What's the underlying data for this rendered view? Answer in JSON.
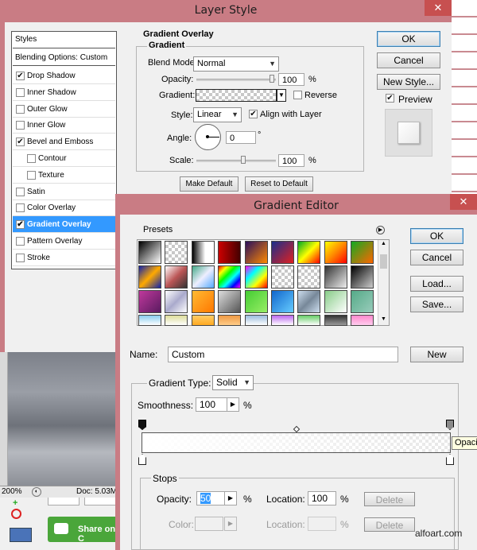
{
  "layer_style": {
    "title": "Layer Style",
    "close": "✕",
    "styles_header": "Styles",
    "blending_options": "Blending Options: Custom",
    "styles": [
      {
        "label": "Drop Shadow",
        "checked": true,
        "indent": false,
        "selected": false
      },
      {
        "label": "Inner Shadow",
        "checked": false,
        "indent": false,
        "selected": false
      },
      {
        "label": "Outer Glow",
        "checked": false,
        "indent": false,
        "selected": false
      },
      {
        "label": "Inner Glow",
        "checked": false,
        "indent": false,
        "selected": false
      },
      {
        "label": "Bevel and Emboss",
        "checked": true,
        "indent": false,
        "selected": false
      },
      {
        "label": "Contour",
        "checked": false,
        "indent": true,
        "selected": false
      },
      {
        "label": "Texture",
        "checked": false,
        "indent": true,
        "selected": false
      },
      {
        "label": "Satin",
        "checked": false,
        "indent": false,
        "selected": false
      },
      {
        "label": "Color Overlay",
        "checked": false,
        "indent": false,
        "selected": false
      },
      {
        "label": "Gradient Overlay",
        "checked": true,
        "indent": false,
        "selected": true
      },
      {
        "label": "Pattern Overlay",
        "checked": false,
        "indent": false,
        "selected": false
      },
      {
        "label": "Stroke",
        "checked": false,
        "indent": false,
        "selected": false
      }
    ],
    "section_title": "Gradient Overlay",
    "group_title": "Gradient",
    "blend_mode_label": "Blend Mode:",
    "blend_mode_value": "Normal",
    "opacity_label": "Opacity:",
    "opacity_value": "100",
    "opacity_unit": "%",
    "opacity_level": 1.0,
    "gradient_label": "Gradient:",
    "reverse_label": "Reverse",
    "reverse_checked": false,
    "style_label": "Style:",
    "style_value": "Linear",
    "align_label": "Align with Layer",
    "align_checked": true,
    "angle_label": "Angle:",
    "angle_value": "0",
    "angle_unit": "°",
    "scale_label": "Scale:",
    "scale_value": "100",
    "scale_unit": "%",
    "make_default": "Make Default",
    "reset_default": "Reset to Default",
    "ok": "OK",
    "cancel": "Cancel",
    "new_style": "New Style...",
    "preview_label": "Preview",
    "preview_checked": true
  },
  "gradient_editor": {
    "title": "Gradient Editor",
    "close": "✕",
    "presets_label": "Presets",
    "ok": "OK",
    "cancel": "Cancel",
    "load": "Load...",
    "save": "Save...",
    "name_label": "Name:",
    "name_value": "Custom",
    "new_button": "New",
    "gradient_type_label": "Gradient Type:",
    "gradient_type_value": "Solid",
    "smoothness_label": "Smoothness:",
    "smoothness_value": "100",
    "smoothness_unit": "%",
    "tooltip": "Opaci",
    "stops_label": "Stops",
    "stop_opacity_label": "Opacity:",
    "stop_opacity_value": "50",
    "stop_opacity_unit": "%",
    "location_label": "Location:",
    "location_value": "100",
    "location_unit": "%",
    "delete": "Delete",
    "color_label": "Color:",
    "color_location_label": "Location:",
    "color_location_unit": "%",
    "color_delete": "Delete"
  },
  "background_app": {
    "zoom": "200%",
    "doc": "Doc: 5.03M",
    "share_label": "Share on C",
    "watermark": "alfoart.com"
  }
}
